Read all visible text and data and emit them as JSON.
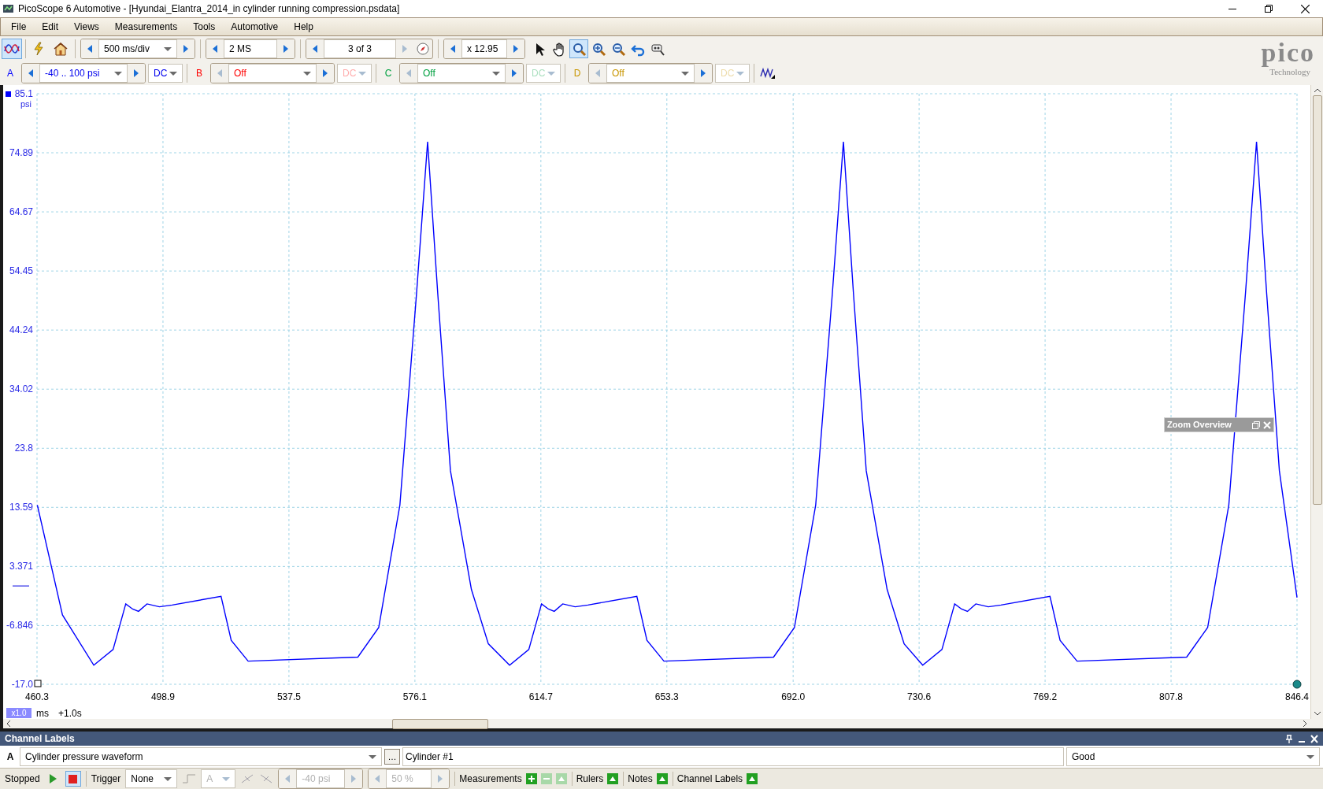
{
  "window": {
    "title": "PicoScope 6 Automotive - [Hyundai_Elantra_2014_in cylinder running compression.psdata]"
  },
  "menu": [
    "File",
    "Edit",
    "Views",
    "Measurements",
    "Tools",
    "Automotive",
    "Help"
  ],
  "toolbar": {
    "scope_mode_selected": true,
    "timebase": "500 ms/div",
    "samples": "2 MS",
    "buffer": "3 of 3",
    "zoom": "x 12.95",
    "tools": [
      {
        "kind": "pointer",
        "selected": false
      },
      {
        "kind": "hand",
        "selected": false
      },
      {
        "kind": "zoom",
        "selected": true
      },
      {
        "kind": "zoom-in",
        "selected": false
      },
      {
        "kind": "zoom-out",
        "selected": false
      },
      {
        "kind": "undo",
        "selected": false
      },
      {
        "kind": "zoom-fit",
        "selected": false
      }
    ]
  },
  "logo": {
    "name": "pico",
    "tagline": "Technology"
  },
  "channels": [
    {
      "letter": "A",
      "range": "-40 .. 100 psi",
      "coupling": "DC",
      "enabled": true,
      "color": "#0000ff"
    },
    {
      "letter": "B",
      "range": "Off",
      "coupling": "DC",
      "enabled": false,
      "color": "#ff0000"
    },
    {
      "letter": "C",
      "range": "Off",
      "coupling": "DC",
      "enabled": false,
      "color": "#00a040"
    },
    {
      "letter": "D",
      "range": "Off",
      "coupling": "DC",
      "enabled": false,
      "color": "#c89600"
    }
  ],
  "plot": {
    "x_scale": "x1.0",
    "offset": "+1.0s",
    "zoom_overview": {
      "title": "Zoom Overview"
    },
    "chart_data": {
      "type": "line",
      "xlabel": "ms",
      "ylabel": "psi",
      "grid": true,
      "xlim": [
        460.3,
        846.4
      ],
      "ylim": [
        -17.0,
        85.1
      ],
      "xticks": [
        460.3,
        498.9,
        537.5,
        576.1,
        614.7,
        653.3,
        {
          "value": 692.0,
          "label": "692.0"
        },
        730.6,
        769.2,
        807.8,
        846.4
      ],
      "yticks": [
        85.1,
        74.89,
        64.67,
        54.45,
        44.24,
        34.02,
        23.8,
        13.59,
        3.371,
        -6.846,
        {
          "value": -17.0,
          "label": "-17.0"
        }
      ],
      "x": [
        460.4,
        468.1,
        477.7,
        483.6,
        487.5,
        489.6,
        491.4,
        494.0,
        497.8,
        501.7,
        516.7,
        519.8,
        525.0,
        558.6,
        565.0,
        571.5,
        576.6,
        580.0,
        583.1,
        587.0,
        593.4,
        598.6,
        605.1,
        611.0,
        614.9,
        617.0,
        618.8,
        621.4,
        625.2,
        629.1,
        644.1,
        647.2,
        652.4,
        686.0,
        692.4,
        698.9,
        704.0,
        707.4,
        710.5,
        714.4,
        720.8,
        726.0,
        731.7,
        737.6,
        741.5,
        743.6,
        745.4,
        748.0,
        751.8,
        755.7,
        770.7,
        773.8,
        779.0,
        812.6,
        819.0,
        825.5,
        830.6,
        834.0,
        837.1,
        841.0,
        846.4
      ],
      "series": [
        {
          "color": "#0000ff",
          "values": [
            14.0,
            -5,
            -13.7,
            -11,
            -3.1,
            -4.0,
            -4.4,
            -3.1,
            -3.6,
            -3.3,
            -1.8,
            -9.4,
            -13.0,
            -12.3,
            -7.2,
            14.0,
            50.5,
            76.8,
            50.5,
            19.9,
            -0.6,
            -10,
            -13.7,
            -11,
            -3.1,
            -4.0,
            -4.4,
            -3.1,
            -3.6,
            -3.3,
            -1.8,
            -9.4,
            -13.0,
            -12.3,
            -7.2,
            14.0,
            50.5,
            76.8,
            50.5,
            19.9,
            -0.6,
            -10,
            -13.7,
            -11,
            -3.1,
            -4.0,
            -4.4,
            -3.1,
            -3.6,
            -3.3,
            -1.8,
            -9.4,
            -13.0,
            -12.3,
            -7.2,
            14.0,
            50.5,
            76.8,
            50.5,
            19.9,
            -2.0
          ]
        }
      ]
    }
  },
  "channel_labels": {
    "title": "Channel Labels",
    "rows": [
      {
        "channel": "A",
        "label": "Cylinder pressure waveform",
        "more_button": "…",
        "name": "Cylinder #1",
        "status": "Good"
      }
    ]
  },
  "status_bar": {
    "state": "Stopped",
    "running": false,
    "trigger_label": "Trigger",
    "trigger_mode": "None",
    "trigger_channel": "A",
    "trigger_level": "-40 psi",
    "pre_trigger": "50 %",
    "trigger_controls_disabled": true,
    "panels": [
      {
        "kind": "measurements",
        "label": "Measurements"
      },
      {
        "kind": "toggle",
        "label": "Rulers"
      },
      {
        "kind": "toggle",
        "label": "Notes"
      },
      {
        "kind": "toggle",
        "label": "Channel Labels"
      }
    ]
  }
}
